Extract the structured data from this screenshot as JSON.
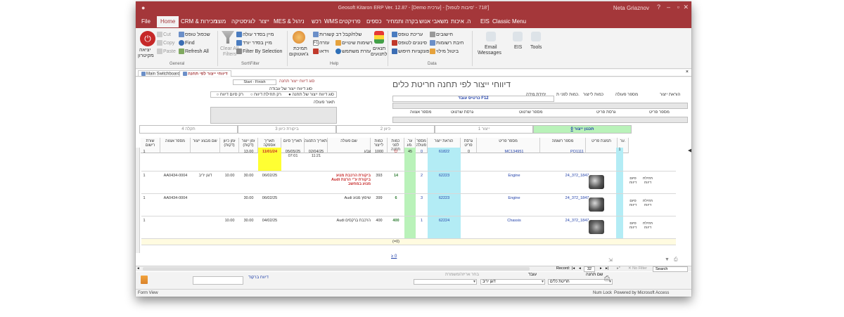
{
  "window": {
    "title": "Geosoft Kitaron ERP Ver. 12.87 - [Demo ערכית] - [718 - 'סיבות לטפול']",
    "user": "Neta Griaznov"
  },
  "menu": [
    "File",
    "Home",
    "CRM & מכירות",
    "מוצר",
    "לוגיסטיקה",
    "ייצור",
    "MES & ניהול",
    "רכש",
    "WMS",
    "פרויקטים",
    "כספים",
    "בקרה ותמחיר",
    "משאבי אנוש",
    "ה. איכות",
    "EIS",
    "Classic Menu"
  ],
  "ribbon": {
    "general": {
      "label": "General",
      "exit": "יציאה",
      "exit2": "מקיטרון",
      "cut": "Cut",
      "copy": "Copy",
      "paste": "Paste",
      "duplicate": "שכפול טופס",
      "find": "Find",
      "refresh": "Refresh All"
    },
    "sort": {
      "label": "Sort\\Filter",
      "asc": "מיין בסדר עולה",
      "desc": "מיין בסדר יורד",
      "clear": "Clear All",
      "clear2": "Filters",
      "by_sel": "Filter By Selection"
    },
    "help": {
      "label": "Help",
      "support1": "תמיכת",
      "support2": "ג'אוטוקום",
      "contact": "שלח/קבל דב קשורות",
      "help": "עזרה",
      "help_key": "F1",
      "videos": "וידאו",
      "lists": "רשימות שינויים",
      "user_help": "עזרת משתמש",
      "cond1": "תנאים",
      "cond2": "לתנועים"
    },
    "data": {
      "label": "Data",
      "edit_form": "עריכת טופס",
      "sort_form": "סינונים לטופס",
      "queries": "פונקציות חיפוש",
      "calc": "חישובים",
      "calc_lists": "חיבת רשומות",
      "cancel_fill": "ביטול מילוי"
    },
    "email": {
      "l1": "Email",
      "l2": "\\Messages"
    },
    "eis": "EIS",
    "tools": "Tools"
  },
  "tabs": {
    "main": "Main Switchboard",
    "active": "דיווחי ייצור לפי תחנה"
  },
  "form": {
    "title": "דיווחי ייצור לפי תחנה חריטת כלים",
    "start_finish": "Start - Finish",
    "report_type_label": "סוג דיווח ייצור תחנה",
    "work_type": "סוג דיווח ייצור של עבודה",
    "radio1": "סוג דיווח ייצור של תחנה",
    "radio2": "רק תחילת דיווח",
    "radio3": "רק סיום דיווח",
    "op_desc": "תאור פעולה",
    "card_label": "כרטיס עובד F12",
    "headers_top": [
      "הוראת ייצור",
      "מספר פעולה",
      "כמות לייצור",
      "כמות לפני ת.",
      "יחידת מידה"
    ],
    "headers_mid": [
      "מספר פריט",
      "גרסת פריט",
      "מספר שרטוט",
      "גרסת שרטוט",
      "מספר אצווה"
    ],
    "tabs": [
      "תכנון ייצור",
      "ייצור",
      "כיוון",
      "ביקורת כיוון",
      "תקלה"
    ],
    "tab_nums": [
      "0",
      "1",
      "2",
      "3",
      "4"
    ]
  },
  "grid": {
    "columns": [
      "ער.",
      "תמונת פריט",
      "מספר רשומה",
      "מספר פריט",
      "גרסת פריט",
      "הוראת ייצור",
      "מספר פעולה",
      "ער. פע.",
      "כמות לפני תחנה",
      "כמות לייצור",
      "שם פעולה",
      "תאריך התנעה",
      "תאריך סיום",
      "תאריך אספקה",
      "זמן ייצור (דקות)",
      "זמן כיוון (דקות)",
      "שם מבצע ייצור",
      "מספר אצווה",
      "שורת רישום"
    ],
    "rows": [
      {
        "num": "1",
        "rec": "PO1111",
        "part": "MC134951",
        "ver": "0",
        "order": "61822",
        "op": "0",
        "fix": "45",
        "before": "D",
        "qty": "1000",
        "name": "צבע",
        "start": "02/04/25 11:21",
        "end": "05/05/25 07:01",
        "supply": "11/01/24",
        "prod": "13.00",
        "setup": "",
        "worker": "",
        "batch": "",
        "line": "1",
        "col1": "1",
        "btn1": "",
        "btn2": ""
      },
      {
        "num": "",
        "rec": "24_372_1847",
        "part": "Engine",
        "ver": "",
        "order": "62223",
        "op": "2",
        "fix": "",
        "before": "14",
        "qty": "393",
        "name": "ביקורת הרכבת מנוע Audi ביקורת ע\"י הרצת מנוע במחשב",
        "start": "",
        "end": "",
        "supply": "06/02/25",
        "prod": "30.00",
        "setup": "10.00",
        "worker": "דוגן יריב",
        "batch": "AA0434-0004",
        "line": "1",
        "col1": "",
        "btn1": "תחילת דיווח",
        "btn2": "סיום דיווח"
      },
      {
        "num": "",
        "rec": "24_372_1847",
        "part": "Engine",
        "ver": "",
        "order": "62223",
        "op": "3",
        "fix": "",
        "before": "6",
        "qty": "399",
        "name": "Audi שיפוץ מנוע",
        "start": "",
        "end": "",
        "supply": "06/02/25",
        "prod": "30.00",
        "setup": "",
        "worker": "",
        "batch": "AA0434-0004",
        "line": "1",
        "col1": "",
        "btn1": "תחילת דיווח",
        "btn2": "סיום דיווח"
      },
      {
        "num": "",
        "rec": "24_372_1847",
        "part": "Chassis",
        "ver": "",
        "order": "62224",
        "op": "1",
        "fix": "",
        "before": "400",
        "qty": "400",
        "name": "Audi הרכבת ברקסים",
        "start": "",
        "end": "",
        "supply": "04/02/25",
        "prod": "30.00",
        "setup": "10.00",
        "worker": "",
        "batch": "",
        "line": "1",
        "col1": "",
        "btn1": "תחילת דיווח",
        "btn2": "סיום דיווח"
      }
    ],
    "total": "(=0)",
    "sum": "≥ 0"
  },
  "nav": {
    "record": "Record:",
    "pos": "32",
    "filter": "No Filter",
    "search": "Search"
  },
  "footer": {
    "station_label": "שם תחנה",
    "station": "חריטת כלים",
    "worker_label": "עובד",
    "worker": "דוגן יריב",
    "barcode": "דיווח ברקוד",
    "remark": "בחר אריזה/משמרת"
  },
  "status": {
    "left": "Form View",
    "right1": "Num Lock",
    "right2": "Powered by Microsoft Access"
  }
}
